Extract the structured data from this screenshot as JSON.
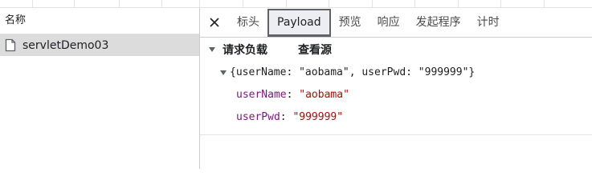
{
  "requests": {
    "header": "名称",
    "items": [
      {
        "name": "servletDemo03",
        "icon": "document-icon"
      }
    ]
  },
  "detail": {
    "tabs": [
      "标头",
      "Payload",
      "预览",
      "响应",
      "发起程序",
      "计时"
    ],
    "active_tab": "Payload",
    "payload": {
      "section_title": "请求负载",
      "view_source_label": "查看源",
      "object_summary": "{userName: \"aobama\", userPwd: \"999999\"}",
      "properties": [
        {
          "key": "userName",
          "sep": ": ",
          "value": "\"aobama\""
        },
        {
          "key": "userPwd",
          "sep": ": ",
          "value": "\"999999\""
        }
      ]
    }
  },
  "colors": {
    "active_tab_border": "#5f6368",
    "key": "#881280",
    "value": "#c80000",
    "selected_row": "#dcdcdc"
  }
}
